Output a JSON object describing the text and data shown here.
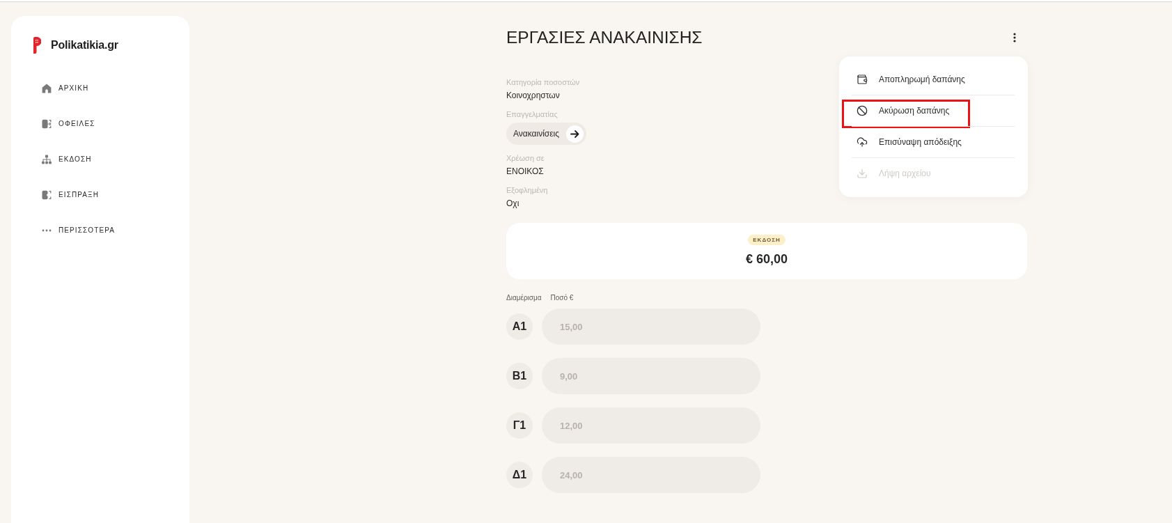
{
  "sidebar": {
    "logo": {
      "text": "Polikatikia.gr"
    },
    "items": [
      {
        "label": "ΑΡΧΙΚΗ",
        "selected": false
      },
      {
        "label": "ΟΦΕΙΛΕΣ",
        "selected": false
      },
      {
        "label": "ΕΚΔΟΣΗ",
        "selected": false
      },
      {
        "label": "ΕΙΣΠΡΑΞΗ",
        "selected": false
      },
      {
        "label": "ΠΕΡΙΣΣΟΤΕΡΑ",
        "selected": false
      }
    ]
  },
  "header": {
    "title": "ΕΡΓΑΣΙΕΣ ΑΝΑΚΑΙΝΙΣΗΣ"
  },
  "details": [
    {
      "kind": "text",
      "label": "Κατηγορία ποσοστών",
      "value": "Κοινοχρηστων"
    },
    {
      "kind": "link",
      "label": "Επαγγελματίας",
      "value": "Ανακαινίσεις"
    },
    {
      "kind": "text",
      "label": "Χρέωση σε",
      "value": "ΕΝΟΙΚΟΣ"
    },
    {
      "kind": "text",
      "label": "Εξοφλημένη",
      "value": "Οχι"
    }
  ],
  "actions_menu": {
    "expanded": true,
    "items": [
      {
        "label": "Αποπληρωμή δαπάνης",
        "disabled": false,
        "highlighted": false
      },
      {
        "label": "Ακύρωση δαπάνης",
        "disabled": false,
        "highlighted": true
      },
      {
        "label": "Επισύναψη απόδειξης",
        "disabled": false,
        "highlighted": false
      },
      {
        "label": "Λήψη αρχείου",
        "disabled": true,
        "highlighted": false
      }
    ]
  },
  "summary": {
    "status": "ΕΚΔΟΣΗ",
    "total": "€ 60,00"
  },
  "allocation": {
    "columns": [
      "Διαμέρισμα",
      "Ποσό €"
    ],
    "rows": [
      {
        "apartment": "Α1",
        "amount": "15,00"
      },
      {
        "apartment": "Β1",
        "amount": "9,00"
      },
      {
        "apartment": "Γ1",
        "amount": "12,00"
      },
      {
        "apartment": "Δ1",
        "amount": "24,00"
      }
    ]
  }
}
